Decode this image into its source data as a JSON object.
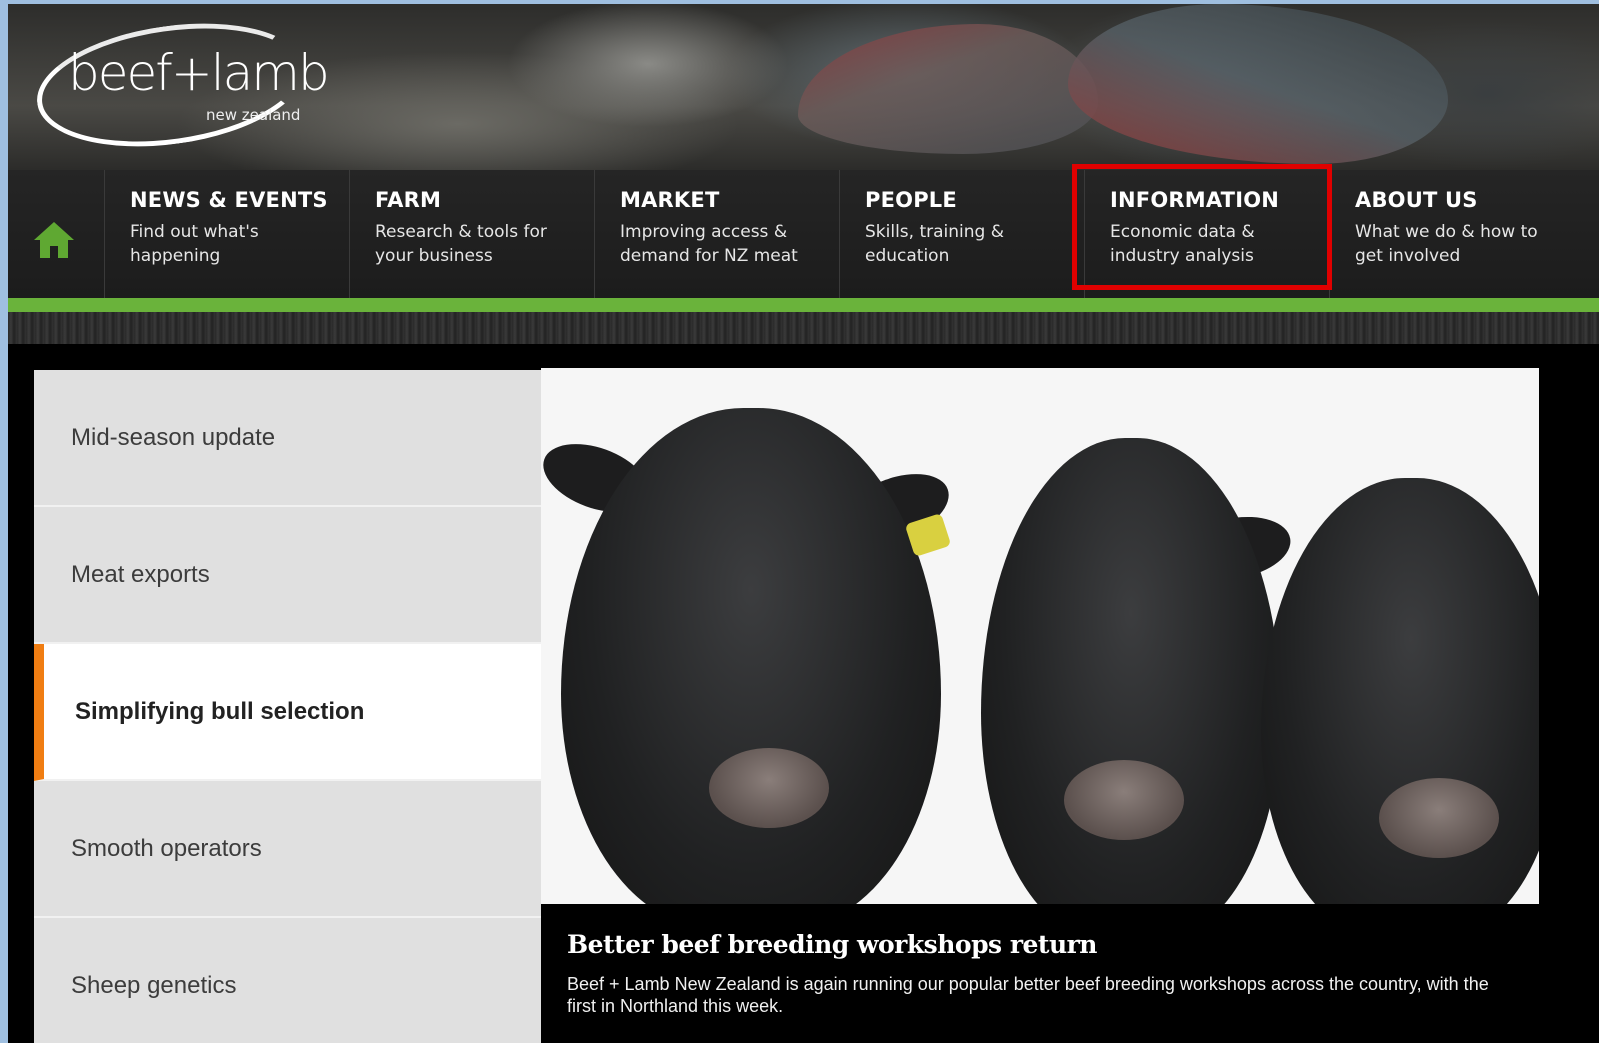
{
  "logo": {
    "main": "beef+lamb",
    "sub": "new zealand"
  },
  "nav": {
    "home_icon": "home-icon",
    "items": [
      {
        "title": "NEWS & EVENTS",
        "desc": "Find out what's happening"
      },
      {
        "title": "FARM",
        "desc": "Research & tools for your business"
      },
      {
        "title": "MARKET",
        "desc": "Improving access & demand for NZ meat"
      },
      {
        "title": "PEOPLE",
        "desc": "Skills, training & education"
      },
      {
        "title": "INFORMATION",
        "desc": "Economic data & industry analysis"
      },
      {
        "title": "ABOUT US",
        "desc": "What we do & how to get involved"
      }
    ]
  },
  "sidebar": {
    "items": [
      {
        "label": "Mid-season update"
      },
      {
        "label": "Meat exports"
      },
      {
        "label": "Simplifying bull selection"
      },
      {
        "label": "Smooth operators"
      },
      {
        "label": "Sheep genetics"
      }
    ],
    "active_index": 2
  },
  "feature": {
    "title": "Better beef breeding workshops return",
    "body": "Beef + Lamb New Zealand is again running our popular better beef breeding workshops across the country, with the first in Northland this week."
  },
  "colors": {
    "nav_accent": "#6ab33b",
    "active_marker": "#f07d12",
    "highlight": "#e00000"
  }
}
